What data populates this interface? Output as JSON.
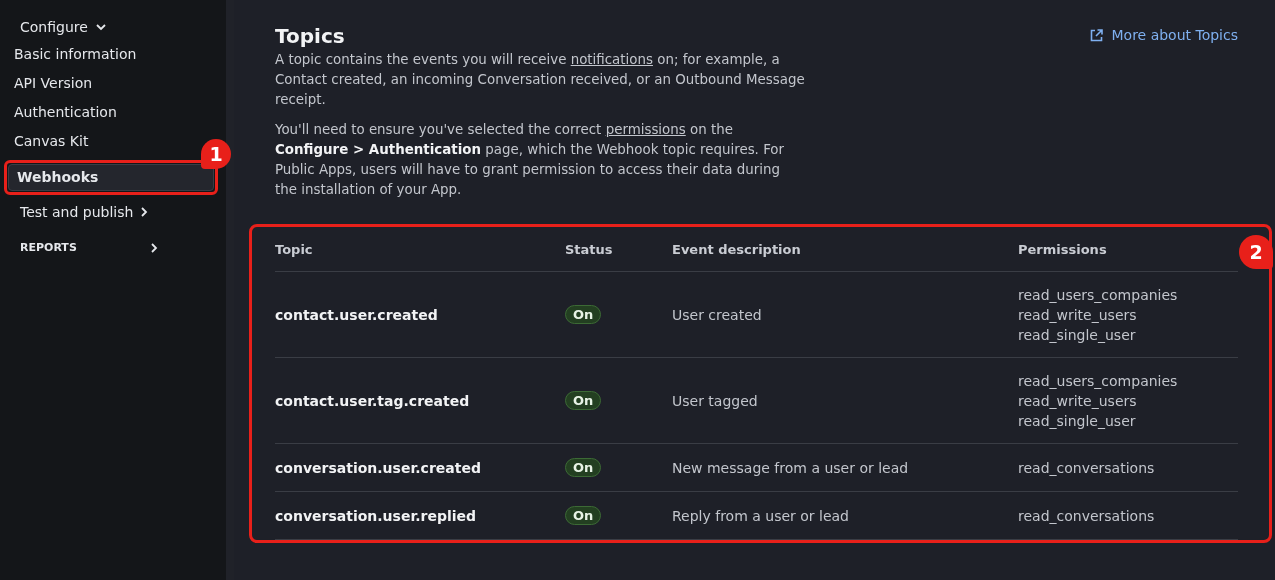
{
  "sidebar": {
    "sections": [
      {
        "label": "Configure",
        "kind": "group",
        "expanded": true,
        "items": [
          {
            "label": "Basic information",
            "selected": false
          },
          {
            "label": "API Version",
            "selected": false
          },
          {
            "label": "Authentication",
            "selected": false
          },
          {
            "label": "Canvas Kit",
            "selected": false
          },
          {
            "label": "Webhooks",
            "selected": true,
            "annotation": "1"
          }
        ]
      },
      {
        "label": "Test and publish",
        "kind": "group",
        "expanded": false
      },
      {
        "label": "REPORTS",
        "kind": "section",
        "expanded": false
      }
    ]
  },
  "content": {
    "title": "Topics",
    "link": "More about Topics",
    "paragraphs": [
      [
        {
          "kind": "text",
          "text": "A topic contains the events you will receive "
        },
        {
          "kind": "link",
          "text": "notifications"
        },
        {
          "kind": "text",
          "text": " on; for example, a Contact created, an incoming Conversation received, or an Outbound Message receipt."
        }
      ],
      [
        {
          "kind": "text",
          "text": "You'll need to ensure you've selected the correct "
        },
        {
          "kind": "link",
          "text": "permissions"
        },
        {
          "kind": "text",
          "text": " on the **Configure > Authentication** page, which the Webhook topic requires. For Public Apps, users will have to grant permission to access their data during the installation of your App."
        }
      ]
    ],
    "table": {
      "annotation": "2",
      "columns": [
        "Topic",
        "Status",
        "Event description",
        "Permissions"
      ],
      "rows": [
        {
          "topic": "contact.user.created",
          "status": "On",
          "on": true,
          "description": "User created",
          "permissions": [
            "read_users_companies",
            "read_write_users",
            "read_single_user"
          ]
        },
        {
          "topic": "contact.user.tag.created",
          "status": "On",
          "on": true,
          "description": "User tagged",
          "permissions": [
            "read_users_companies",
            "read_write_users",
            "read_single_user"
          ]
        },
        {
          "topic": "conversation.user.created",
          "status": "On",
          "on": true,
          "description": "New message from a user or lead",
          "permissions": [
            "read_conversations"
          ]
        },
        {
          "topic": "conversation.user.replied",
          "status": "On",
          "on": true,
          "description": "Reply from a user or lead",
          "permissions": [
            "read_conversations"
          ]
        }
      ]
    }
  }
}
